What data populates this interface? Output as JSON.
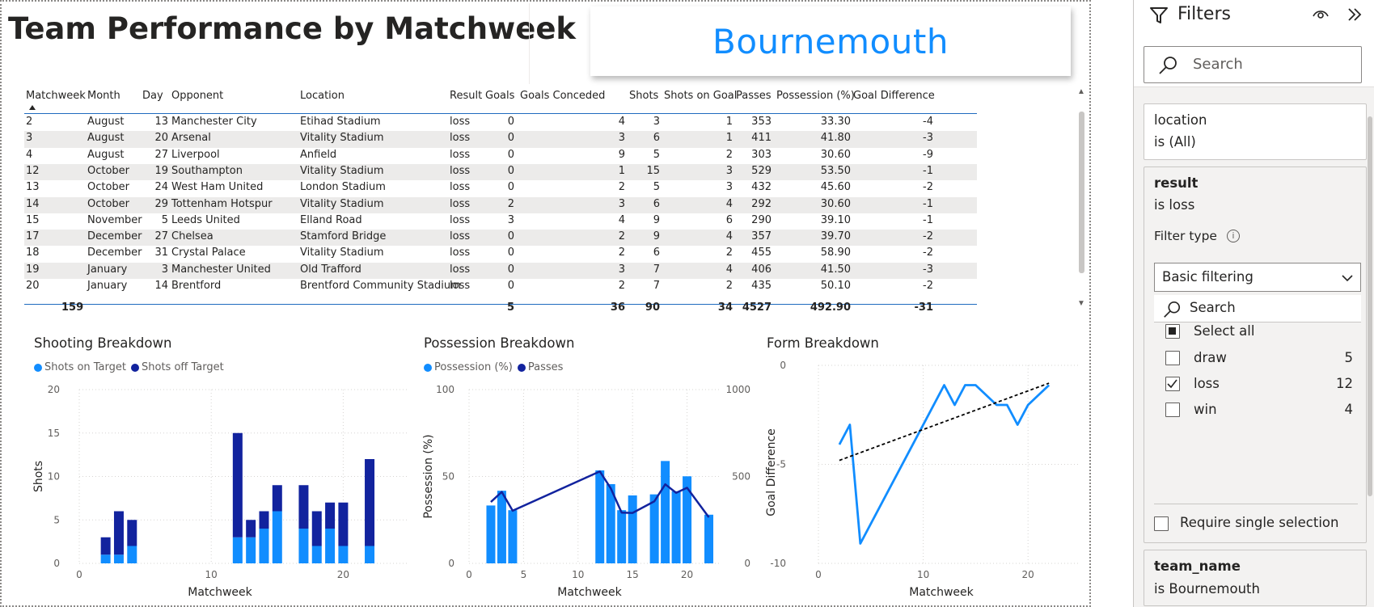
{
  "title": "Team Performance by Matchweek",
  "team_card": "Bournemouth",
  "table": {
    "columns": [
      "Matchweek",
      "Month",
      "Day",
      "Opponent",
      "Location",
      "Result",
      "Goals",
      "Goals Conceded",
      "Shots",
      "Shots on Goal",
      "Passes",
      "Possession (%)",
      "Goal Difference"
    ],
    "rows": [
      [
        "2",
        "August",
        "13",
        "Manchester City",
        "Etihad Stadium",
        "loss",
        "0",
        "4",
        "3",
        "1",
        "353",
        "33.30",
        "-4"
      ],
      [
        "3",
        "August",
        "20",
        "Arsenal",
        "Vitality Stadium",
        "loss",
        "0",
        "3",
        "6",
        "1",
        "411",
        "41.80",
        "-3"
      ],
      [
        "4",
        "August",
        "27",
        "Liverpool",
        "Anfield",
        "loss",
        "0",
        "9",
        "5",
        "2",
        "303",
        "30.60",
        "-9"
      ],
      [
        "12",
        "October",
        "19",
        "Southampton",
        "Vitality Stadium",
        "loss",
        "0",
        "1",
        "15",
        "3",
        "529",
        "53.50",
        "-1"
      ],
      [
        "13",
        "October",
        "24",
        "West Ham United",
        "London Stadium",
        "loss",
        "0",
        "2",
        "5",
        "3",
        "432",
        "45.60",
        "-2"
      ],
      [
        "14",
        "October",
        "29",
        "Tottenham Hotspur",
        "Vitality Stadium",
        "loss",
        "2",
        "3",
        "6",
        "4",
        "292",
        "30.60",
        "-1"
      ],
      [
        "15",
        "November",
        "5",
        "Leeds United",
        "Elland Road",
        "loss",
        "3",
        "4",
        "9",
        "6",
        "290",
        "39.10",
        "-1"
      ],
      [
        "17",
        "December",
        "27",
        "Chelsea",
        "Stamford Bridge",
        "loss",
        "0",
        "2",
        "9",
        "4",
        "357",
        "39.70",
        "-2"
      ],
      [
        "18",
        "December",
        "31",
        "Crystal Palace",
        "Vitality Stadium",
        "loss",
        "0",
        "2",
        "6",
        "2",
        "455",
        "58.90",
        "-2"
      ],
      [
        "19",
        "January",
        "3",
        "Manchester United",
        "Old Trafford",
        "loss",
        "0",
        "3",
        "7",
        "4",
        "406",
        "41.50",
        "-3"
      ],
      [
        "20",
        "January",
        "14",
        "Brentford",
        "Brentford Community Stadium",
        "loss",
        "0",
        "2",
        "7",
        "2",
        "435",
        "50.10",
        "-2"
      ]
    ],
    "totals": [
      "159",
      "",
      "",
      "",
      "",
      "",
      "5",
      "36",
      "90",
      "34",
      "4527",
      "492.90",
      "-31"
    ]
  },
  "charts": {
    "shooting": {
      "title": "Shooting Breakdown",
      "legend": [
        "Shots on Target",
        "Shots off Target"
      ]
    },
    "possession": {
      "title": "Possession Breakdown",
      "legend": [
        "Possession (%)",
        "Passes"
      ]
    },
    "form": {
      "title": "Form Breakdown"
    }
  },
  "chart_data": [
    {
      "type": "bar",
      "title": "Shooting Breakdown",
      "stacked": true,
      "x": [
        2,
        3,
        4,
        12,
        13,
        14,
        15,
        17,
        18,
        19,
        20,
        22
      ],
      "series": [
        {
          "name": "Shots on Target",
          "color": "#118dff",
          "values": [
            1,
            1,
            2,
            3,
            3,
            4,
            6,
            4,
            2,
            4,
            2,
            2
          ]
        },
        {
          "name": "Shots off Target",
          "color": "#12239e",
          "values": [
            2,
            5,
            3,
            12,
            2,
            2,
            3,
            5,
            4,
            3,
            5,
            10
          ]
        }
      ],
      "xlabel": "Matchweek",
      "ylabel": "Shots",
      "xlim": [
        0,
        25
      ],
      "ylim": [
        0,
        20
      ],
      "xticks": [
        0,
        10,
        20
      ],
      "yticks": [
        0,
        5,
        10,
        15,
        20
      ],
      "grid": true,
      "legend": "top-left"
    },
    {
      "type": "bar",
      "title": "Possession Breakdown",
      "x": [
        2,
        3,
        4,
        12,
        13,
        14,
        15,
        17,
        18,
        19,
        20,
        22
      ],
      "series": [
        {
          "name": "Possession (%)",
          "color": "#118dff",
          "axis": "left",
          "kind": "bar",
          "values": [
            33.3,
            41.8,
            30.6,
            53.5,
            45.6,
            30.6,
            39.1,
            39.7,
            58.9,
            41.5,
            50.1,
            28.0
          ]
        },
        {
          "name": "Passes",
          "color": "#12239e",
          "axis": "right",
          "kind": "line",
          "values": [
            353,
            411,
            303,
            529,
            432,
            292,
            290,
            357,
            455,
            406,
            435,
            265
          ]
        }
      ],
      "xlabel": "Matchweek",
      "ylabel": "Possession (%)",
      "xlim": [
        0,
        23
      ],
      "ylim": [
        0,
        100
      ],
      "y2lim": [
        0,
        1000
      ],
      "xticks": [
        0,
        5,
        10,
        15,
        20
      ],
      "yticks": [
        0,
        50,
        100
      ],
      "y2ticks": [
        0,
        500,
        1000
      ],
      "grid": true,
      "legend": "top-left"
    },
    {
      "type": "line",
      "title": "Form Breakdown",
      "x": [
        2,
        3,
        4,
        12,
        13,
        14,
        15,
        17,
        18,
        19,
        20,
        22
      ],
      "series": [
        {
          "name": "Goal Difference",
          "color": "#118dff",
          "values": [
            -4,
            -3,
            -9,
            -1,
            -2,
            -1,
            -1,
            -2,
            -2,
            -3,
            -2,
            -1
          ]
        }
      ],
      "trendline": {
        "from": [
          2,
          -4.8
        ],
        "to": [
          22,
          -0.9
        ],
        "style": "dashed",
        "color": "#000000"
      },
      "xlabel": "Matchweek",
      "ylabel": "Goal Difference",
      "xlim": [
        0,
        25
      ],
      "ylim": [
        -10,
        0
      ],
      "xticks": [
        0,
        10,
        20
      ],
      "yticks": [
        0,
        -5,
        -10
      ],
      "grid": true
    }
  ],
  "filters": {
    "title": "Filters",
    "search_placeholder": "Search",
    "location": {
      "field": "location",
      "state": "is (All)"
    },
    "result": {
      "field": "result",
      "state": "is loss",
      "filter_type_label": "Filter type",
      "filter_type_value": "Basic filtering",
      "search_placeholder": "Search",
      "select_all": "Select all",
      "options": [
        {
          "label": "draw",
          "count": "5",
          "checked": false
        },
        {
          "label": "loss",
          "count": "12",
          "checked": true
        },
        {
          "label": "win",
          "count": "4",
          "checked": false
        }
      ],
      "require_single": "Require single selection"
    },
    "team_name": {
      "field": "team_name",
      "state": "is Bournemouth"
    }
  }
}
